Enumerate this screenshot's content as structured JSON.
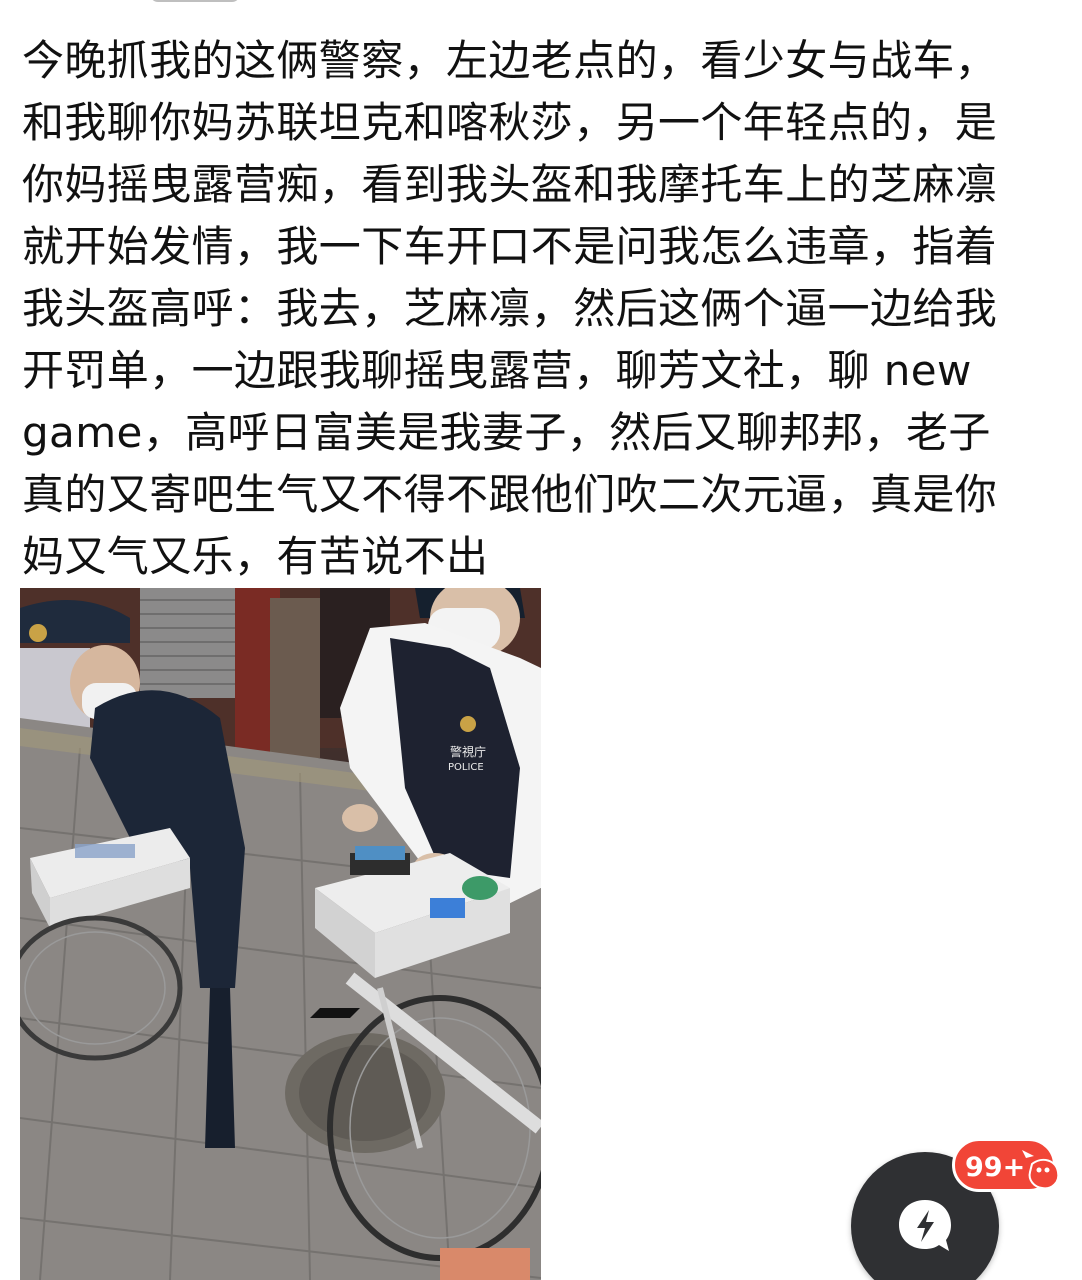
{
  "post": {
    "lines": [
      "今晚抓我的这俩警察，左边老点的，看少女与战车，",
      "和我聊你妈苏联坦克和喀秋莎，另一个年轻点的，是",
      "你妈摇曳露营痴，看到我头盔和我摩托车上的芝麻凛",
      "就开始发情，我一下车开口不是问我怎么违章，指着",
      "我头盔高呼：我去，芝麻凛，然后这俩个逼一边给我",
      "开罚单，一边跟我聊摇曳露营，聊芳文社，聊 new",
      "game，高呼日富美是我妻子，然后又聊邦邦，老子",
      "真的又寄吧生气又不得不跟他们吹二次元逼，真是你",
      "妈又气又乐，有苦说不出"
    ]
  },
  "photo": {
    "vest_text_1": "警視庁",
    "vest_text_2": "POLICE"
  },
  "notification": {
    "badge_count": "99+",
    "badge_color": "#f14537",
    "fab_color": "#2f3033",
    "fab_icon": "chat-bubble-lightning-icon"
  }
}
